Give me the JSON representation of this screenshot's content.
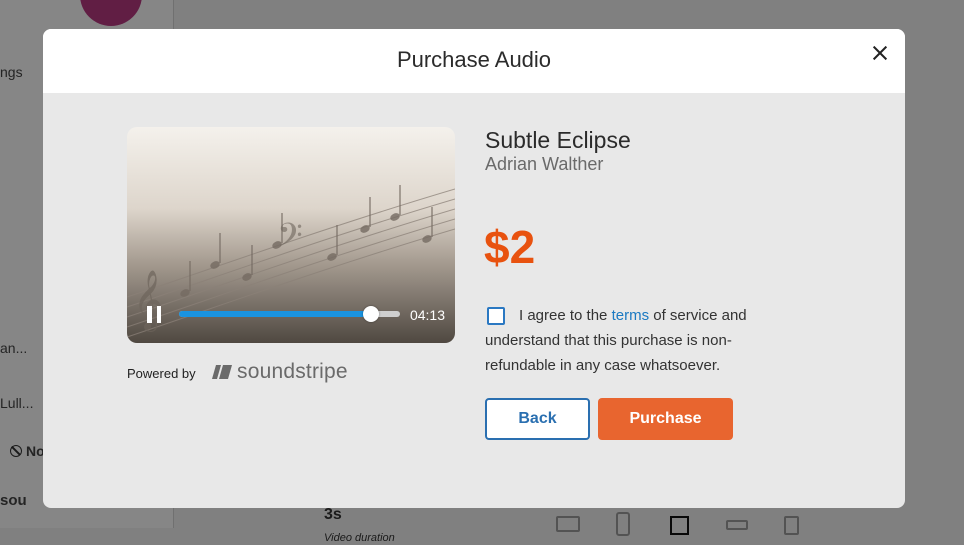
{
  "background": {
    "sidebar_settings": "ngs",
    "sidebar_item_1": "an...",
    "sidebar_item_2": "Lull...",
    "sidebar_none": "No",
    "sidebar_logo": "sou",
    "duration_value": "3s",
    "duration_label": "Video duration"
  },
  "modal": {
    "title": "Purchase Audio",
    "player": {
      "time": "04:13",
      "progress_fraction": 0.87,
      "powered_by": "Powered by",
      "brand": "soundstripe"
    },
    "track": {
      "title": "Subtle Eclipse",
      "artist": "Adrian Walther",
      "price": "$2"
    },
    "agreement": {
      "prefix": "I agree to the ",
      "link": "terms",
      "suffix": " of service and understand that this purchase is non-refundable in any case whatsoever."
    },
    "buttons": {
      "back": "Back",
      "purchase": "Purchase"
    }
  },
  "colors": {
    "price": "#e8520f",
    "purchase_button": "#e8652f",
    "back_button": "#2a6fb0",
    "progress": "#1a93e0",
    "link": "#1a79c2"
  },
  "icons": [
    "close-icon",
    "pause-icon",
    "checkbox-icon",
    "soundstripe-logo-icon",
    "laptop-icon",
    "phone-icon",
    "square-icon",
    "landscape-icon",
    "portrait-icon"
  ]
}
